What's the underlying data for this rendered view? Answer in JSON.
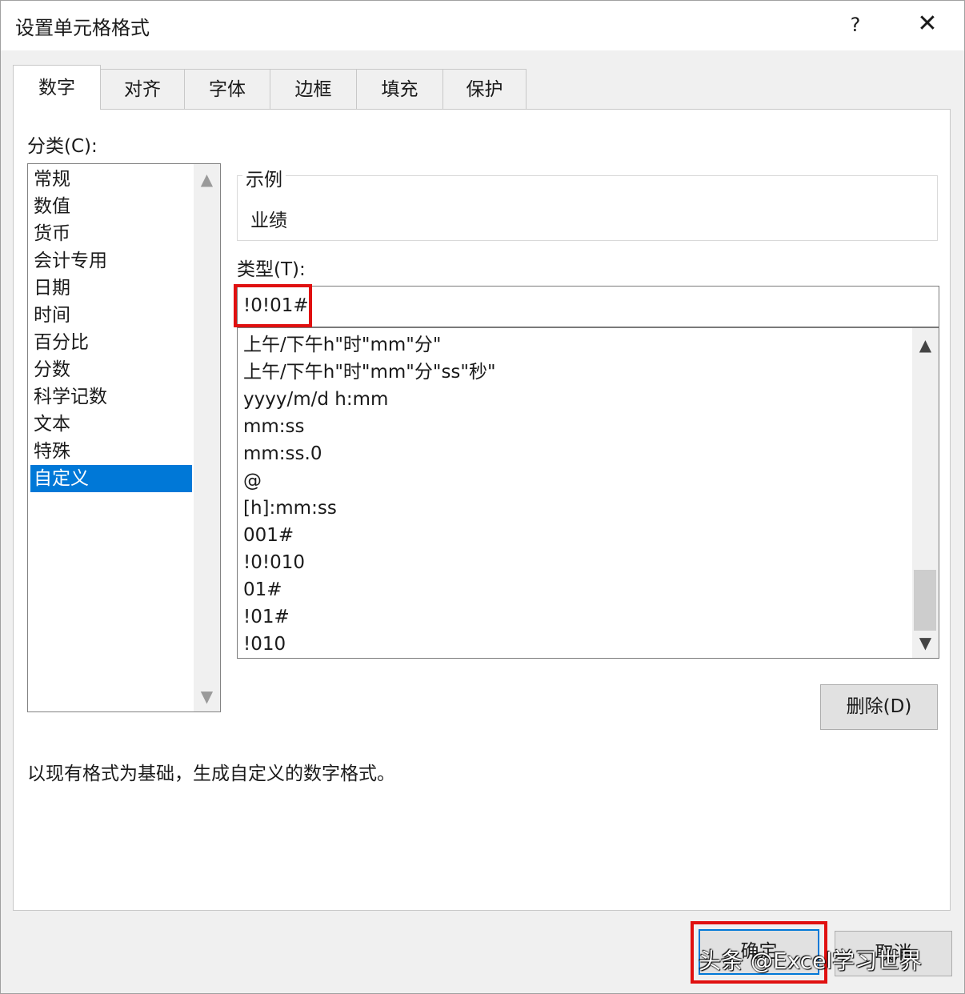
{
  "window": {
    "title": "设置单元格格式",
    "help_label": "?",
    "close_label": "✕"
  },
  "tabs": [
    {
      "label": "数字",
      "active": true
    },
    {
      "label": "对齐"
    },
    {
      "label": "字体"
    },
    {
      "label": "边框"
    },
    {
      "label": "填充"
    },
    {
      "label": "保护"
    }
  ],
  "category": {
    "label": "分类(C):",
    "items": [
      "常规",
      "数值",
      "货币",
      "会计专用",
      "日期",
      "时间",
      "百分比",
      "分数",
      "科学记数",
      "文本",
      "特殊",
      "自定义"
    ],
    "selected": "自定义"
  },
  "sample": {
    "legend": "示例",
    "value": "业绩"
  },
  "type": {
    "label": "类型(T):",
    "value": "!0!01#",
    "formats": [
      "上午/下午h\"时\"mm\"分\"",
      "上午/下午h\"时\"mm\"分\"ss\"秒\"",
      "yyyy/m/d h:mm",
      "mm:ss",
      "mm:ss.0",
      "@",
      "[h]:mm:ss",
      "001#",
      "!0!010",
      "01#",
      "!01#",
      "!010"
    ]
  },
  "delete_button": "删除(D)",
  "description": "以现有格式为基础，生成自定义的数字格式。",
  "ok_button": "确定",
  "cancel_button": "取消",
  "watermark": "头条 @Excel学习世界",
  "colors": {
    "selection": "#0078d7",
    "highlight_red": "#e01010"
  },
  "icons": {
    "scroll_up": "▲",
    "scroll_down": "▼"
  }
}
